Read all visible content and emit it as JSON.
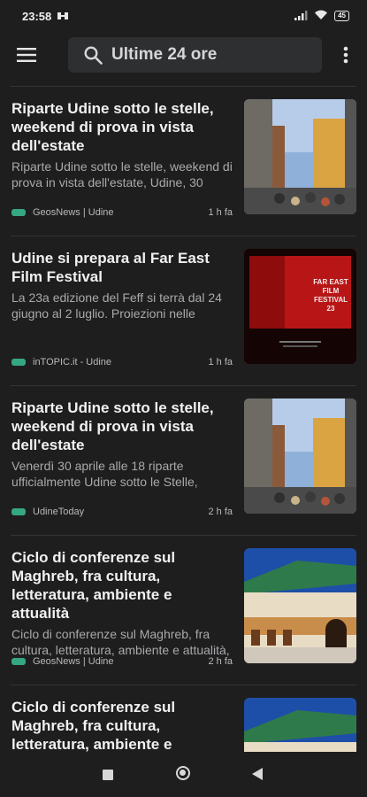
{
  "status_bar": {
    "time": "23:58",
    "battery": "45"
  },
  "search": {
    "query": "Ultime 24 ore"
  },
  "articles": [
    {
      "title": "Riparte Udine sotto le stelle, weekend di prova in vista dell'estate",
      "snippet": "Riparte Udine sotto le stelle, weekend di prova in vista dell'estate, Udine, 30",
      "source": "GeosNews | Udine",
      "time": "1 h fa",
      "thumbnail": "street-scene"
    },
    {
      "title": "Udine si prepara al Far East Film Festival",
      "snippet": "La 23a edizione del Feff si terrà dal 24 giugno al 2 luglio. Proiezioni nelle",
      "source": "inTOPIC.it - Udine",
      "time": "1 h fa",
      "thumbnail": "festival-poster",
      "thumbnail_text": [
        "FAR EAST",
        "FILM",
        "FESTIVAL",
        "23"
      ]
    },
    {
      "title": "Riparte Udine sotto le stelle, weekend di prova in vista dell'estate",
      "snippet": "Venerdì 30 aprile alle 18 riparte ufficialmente Udine sotto le Stelle,",
      "source": "UdineToday",
      "time": "2 h fa",
      "thumbnail": "street-scene"
    },
    {
      "title": "Ciclo di conferenze sul Maghreb, fra cultura, letteratura, ambiente e attualità",
      "snippet": "Ciclo di conferenze sul Maghreb, fra cultura, letteratura, ambiente e attualità,",
      "source": "GeosNews | Udine",
      "time": "2 h fa",
      "thumbnail": "moroccan-building"
    },
    {
      "title": "Ciclo di conferenze sul Maghreb, fra cultura, letteratura, ambiente e attualità",
      "snippet": "",
      "source": "",
      "time": "",
      "thumbnail": "moroccan-building"
    }
  ],
  "icons": {
    "menu": "hamburger-icon",
    "search": "search-icon",
    "more": "more-vertical-icon",
    "source_tag": "tag-icon"
  },
  "colors": {
    "background": "#1e1e1f",
    "search_bg": "#2e2f31",
    "tag_green": "#36a783"
  }
}
